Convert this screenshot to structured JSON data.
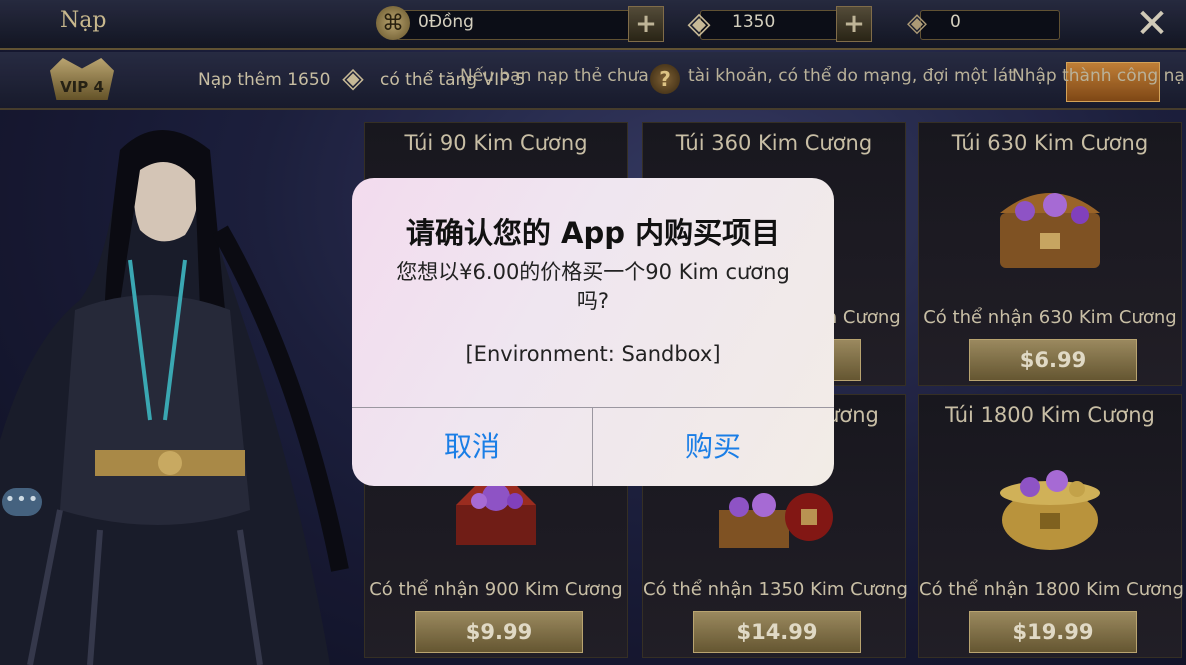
{
  "header": {
    "title": "Nạp",
    "currency_dong": "0Đồng",
    "diamonds": "1350",
    "locked_diamonds": "0",
    "plus_label": "+",
    "close_label": "✕"
  },
  "vip": {
    "badge": "VIP 4",
    "text_prefix": "Nạp thêm 1650",
    "text_suffix": "có thể tăng VIP 5",
    "help_label": "?",
    "notice_left": "Nếu bạn nạp thẻ chưa",
    "notice_right": "tài khoản, có thể do mạng, đợi một lát",
    "notice_overlap": "Nhập thành công nạp"
  },
  "packs": [
    {
      "title": "Túi 90 Kim Cương",
      "desc": "",
      "price": ""
    },
    {
      "title": "Túi 360 Kim Cương",
      "desc": "Có thể nhận 360 Kim Cương",
      "price": ""
    },
    {
      "title": "Túi 630 Kim Cương",
      "desc": "Có thể nhận 630 Kim Cương",
      "price": "$6.99"
    },
    {
      "title": "",
      "desc": "Có thể nhận 900 Kim Cương",
      "price": "$9.99"
    },
    {
      "title": "Túi 1350 Kim Cương",
      "desc": "Có thể nhận 1350 Kim Cương",
      "price": "$14.99"
    },
    {
      "title": "Túi 1800 Kim Cương",
      "desc": "Có thể nhận 1800 Kim Cương",
      "price": "$19.99"
    }
  ],
  "chat": {
    "label": "•••"
  },
  "dialog": {
    "title": "请确认您的 App 内购买项目",
    "message": "您想以¥6.00的价格买一个90 Kim cương吗?",
    "environment": "[Environment: Sandbox]",
    "cancel_label": "取消",
    "buy_label": "购买"
  },
  "colors": {
    "accent_blue": "#1a7ee6",
    "gold": "#c9b27a"
  }
}
